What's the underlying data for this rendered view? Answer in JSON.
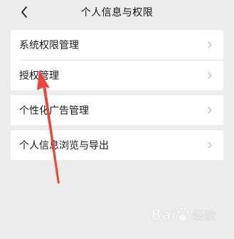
{
  "header": {
    "title": "个人信息与权限",
    "back_icon": "chevron-left-icon"
  },
  "menu": {
    "group1": [
      {
        "label": "系统权限管理"
      },
      {
        "label": "授权管理"
      }
    ],
    "group2": [
      {
        "label": "个性化广告管理"
      }
    ],
    "group3": [
      {
        "label": "个人信息浏览与导出"
      }
    ]
  },
  "annotation": {
    "arrow_color": "#e8473b"
  },
  "watermark": {
    "brand": "Baidu 经验",
    "logo": "paw-logo"
  }
}
